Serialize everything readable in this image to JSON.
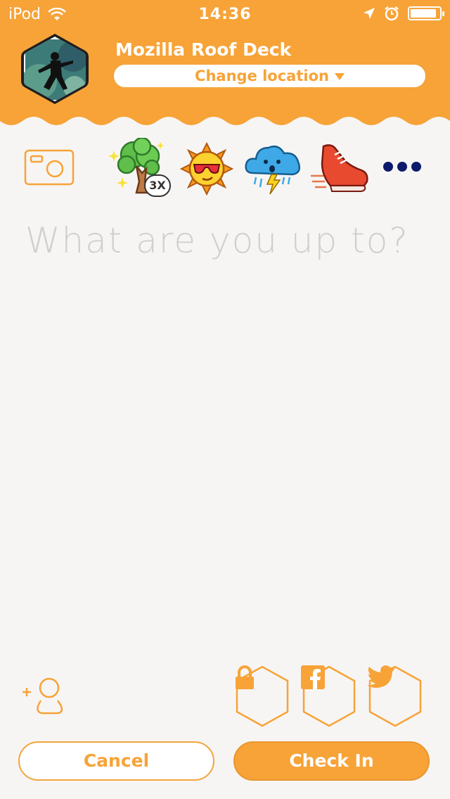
{
  "status_bar": {
    "carrier": "iPod",
    "time": "14:36",
    "battery_level": 0.9
  },
  "header": {
    "venue_name": "Mozilla Roof Deck",
    "change_location_label": "Change location",
    "background_color": "#f7a338"
  },
  "stickers": [
    {
      "name": "tree-sticker",
      "multiplier": "3X"
    },
    {
      "name": "sun-sunglasses-sticker"
    },
    {
      "name": "storm-cloud-sticker"
    },
    {
      "name": "sneaker-sticker"
    }
  ],
  "composer": {
    "placeholder": "What are you up to?"
  },
  "actions": {
    "cancel_label": "Cancel",
    "checkin_label": "Check In"
  },
  "colors": {
    "accent": "#f7a338",
    "placeholder_text": "#cfcfcf",
    "more_dots": "#0d1a6b"
  }
}
